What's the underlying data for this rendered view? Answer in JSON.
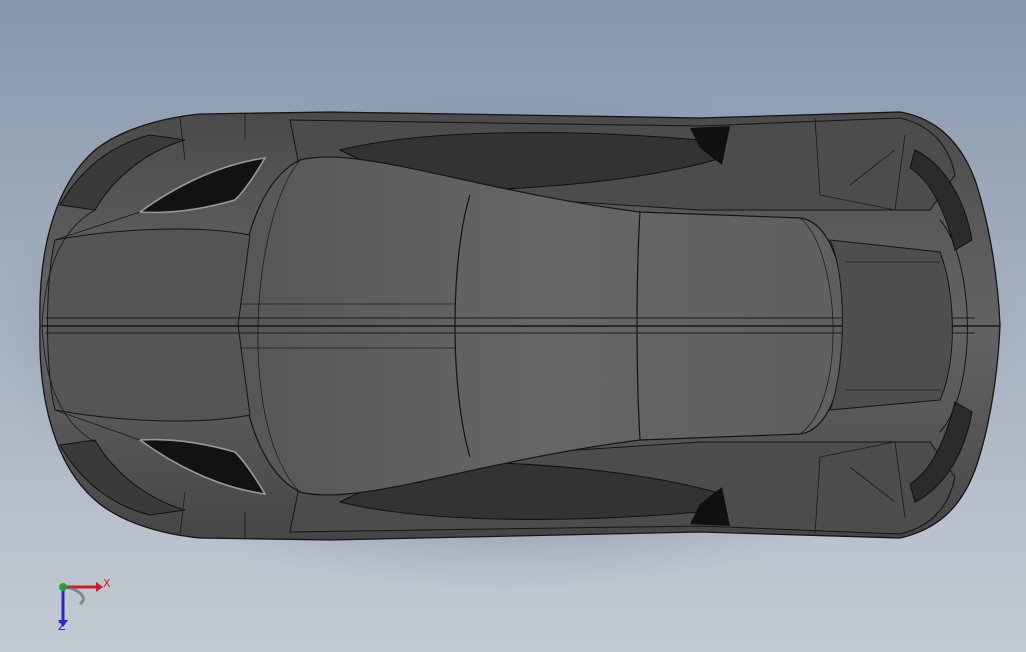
{
  "viewport": {
    "background_top": "#8797ac",
    "background_bottom": "#c3cad3",
    "model": {
      "type": "car-body-top-view",
      "display_style": "shaded-with-edges",
      "body_color": "#5a5a5a",
      "edge_color": "#111111"
    }
  },
  "triad": {
    "x_label": "X",
    "z_label": "Z",
    "x_color": "#cc1f1f",
    "y_color": "#22aa22",
    "z_color": "#2a2ab8"
  }
}
